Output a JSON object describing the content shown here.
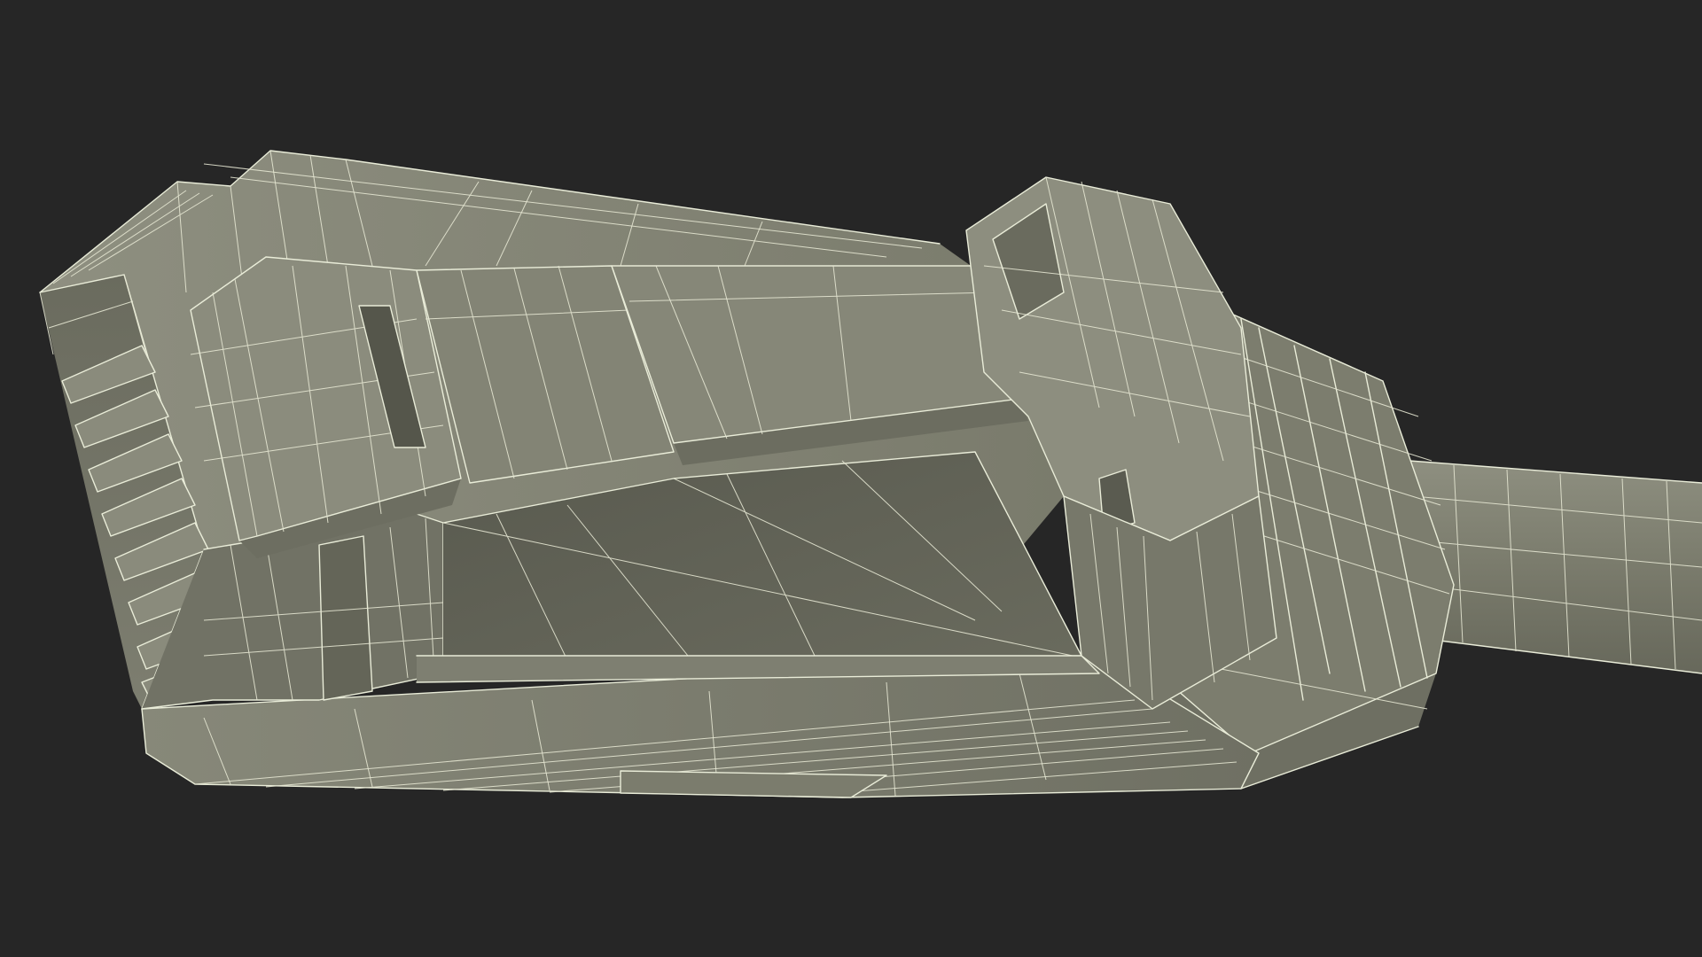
{
  "viewport": {
    "background_color": "#262626"
  },
  "model": {
    "subject": "rj45-connector-plug-wireframe",
    "view_mode": "shaded-wireframe",
    "colors": {
      "surface_light": "#8a8b7c",
      "surface_mid": "#7b7c6d",
      "surface_dark": "#5f6054",
      "surface_shadow": "#4c4d43",
      "wire": "#e9ecd8"
    }
  }
}
